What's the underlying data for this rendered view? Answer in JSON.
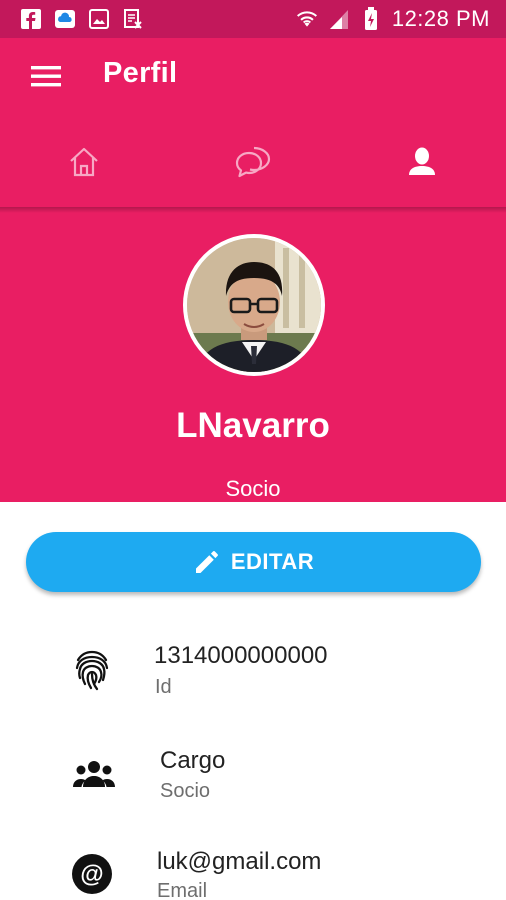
{
  "status_bar": {
    "time": "12:28 PM",
    "icons": [
      "facebook-icon",
      "cloud-app-icon",
      "gallery-icon",
      "document-icon",
      "wifi-icon",
      "signal-icon",
      "battery-charging-icon"
    ]
  },
  "app_bar": {
    "title": "Perfil",
    "menu_icon": "hamburger-menu-icon"
  },
  "tabs": [
    {
      "icon": "home-icon",
      "active": false
    },
    {
      "icon": "chat-icon",
      "active": false
    },
    {
      "icon": "person-icon",
      "active": true
    }
  ],
  "profile": {
    "username": "LNavarro",
    "role": "Socio"
  },
  "edit_button": {
    "label": "EDITAR",
    "icon": "pencil-icon"
  },
  "info": [
    {
      "icon": "fingerprint-icon",
      "value": "1314000000000",
      "label": "Id"
    },
    {
      "icon": "group-icon",
      "value": "Cargo",
      "label": "Socio"
    },
    {
      "icon": "at-sign-icon",
      "value": "luk@gmail.com",
      "label": "Email"
    }
  ],
  "colors": {
    "status_bar": "#c2185b",
    "primary": "#e91e63",
    "accent": "#1eaaf1",
    "text_primary": "#222222",
    "text_secondary": "#6e6e6e"
  }
}
